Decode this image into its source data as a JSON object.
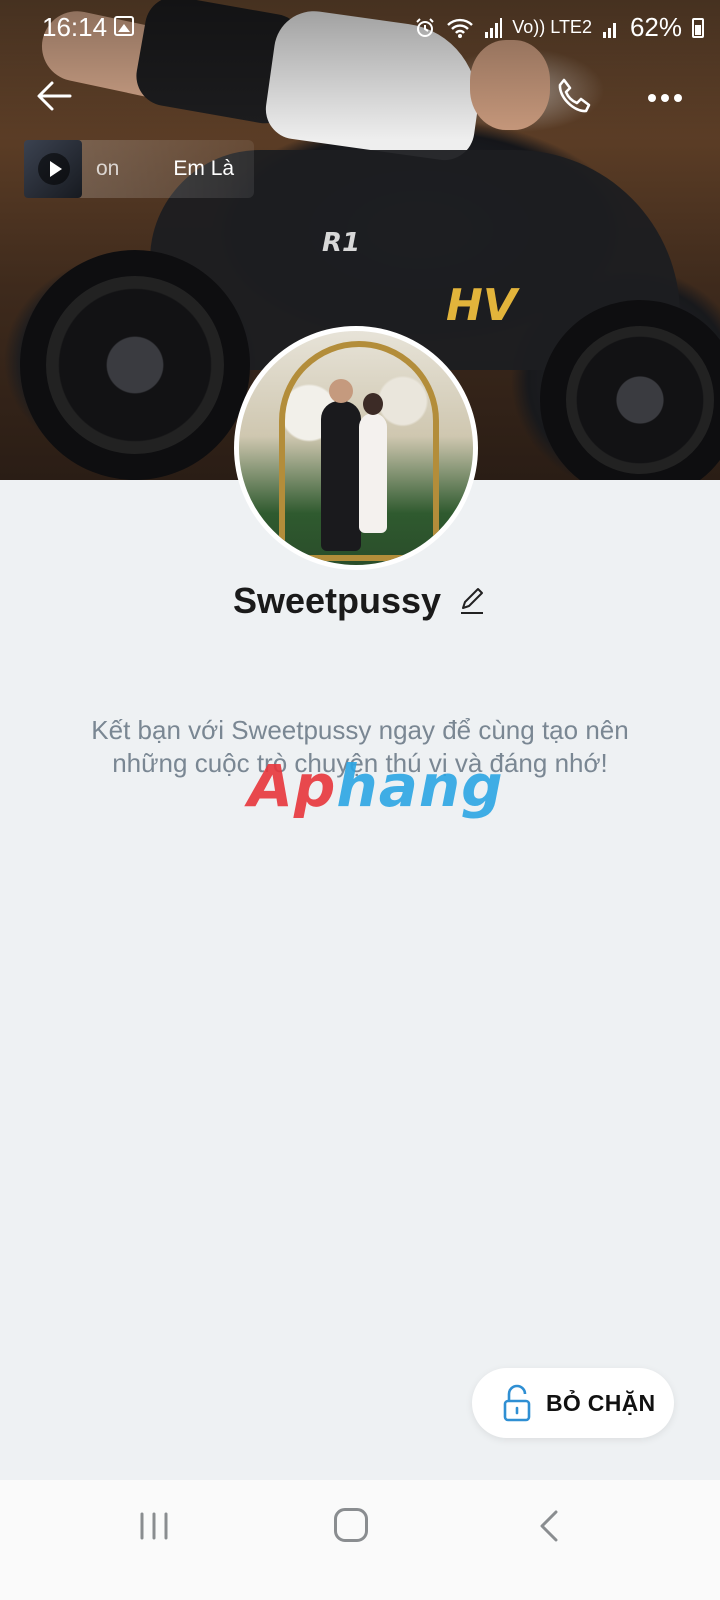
{
  "status_bar": {
    "time": "16:14",
    "network_label": "Vo)) LTE2",
    "battery": "62%"
  },
  "cover": {
    "decal_hv": "HV",
    "decal_r1": "R1"
  },
  "music": {
    "title_part1": "on",
    "title_part2": "Em Là"
  },
  "profile": {
    "name": "Sweetpussy",
    "description": "Kết bạn với Sweetpussy ngay để cùng tạo nên những cuộc trò chuyện thú vị và đáng nhớ!"
  },
  "watermark": {
    "part_a": "Ap",
    "part_b": "hang"
  },
  "actions": {
    "unblock_label": "BỎ CHẶN"
  },
  "icons": {
    "back": "back-arrow-icon",
    "call": "phone-icon",
    "more": "more-dots-icon",
    "edit": "pencil-icon",
    "unlock": "unlock-icon",
    "play": "play-icon"
  },
  "colors": {
    "background": "#eef1f3",
    "description_text": "#7a8793",
    "unlock_icon": "#2f8fd3",
    "watermark_red": "#e8363c",
    "watermark_blue": "#2da6e4"
  }
}
